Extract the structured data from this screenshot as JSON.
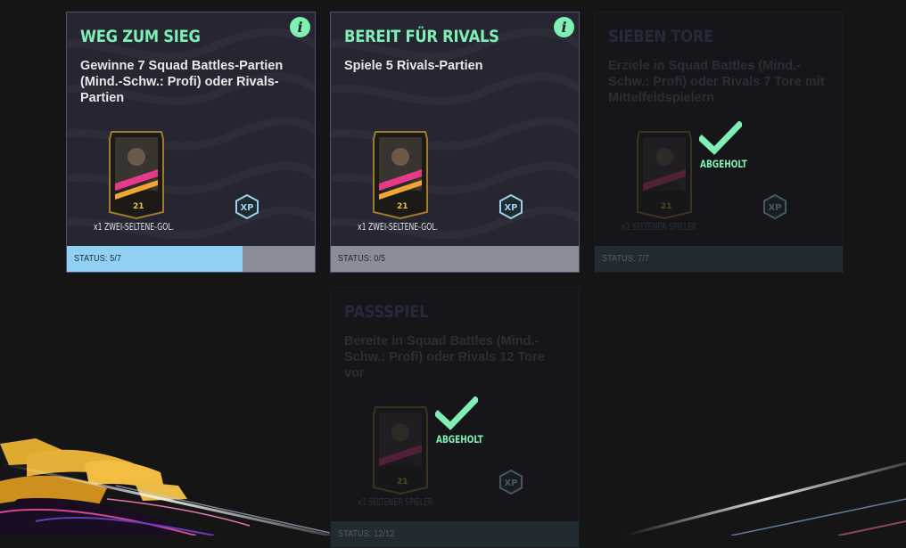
{
  "colors": {
    "accent": "#7ef0b4",
    "progress": "#8fd0f3",
    "card_bg": "#262632"
  },
  "objectives": [
    {
      "title": "WEG ZUM SIEG",
      "description": "Gewinne 7 Squad Battles-Partien (Mind.-Schw.: Profi) oder Rivals-Partien",
      "reward": "x1 ZWEI-SELTENE-GOL...",
      "status": "STATUS: 5/7",
      "progress": 0.71,
      "info_icon": "info-icon",
      "xp_icon": "xp-icon"
    },
    {
      "title": "BEREIT FÜR RIVALS",
      "description": "Spiele 5 Rivals-Partien",
      "reward": "x1 ZWEI-SELTENE-GOL...",
      "status": "STATUS: 0/5",
      "progress": 0.0,
      "info_icon": "info-icon",
      "xp_icon": "xp-icon"
    },
    {
      "title": "SIEBEN TORE",
      "description": "Erziele in Squad Battles (Mind.-Schw.: Profi) oder Rivals 7 Tore mit Mittelfeldspielern",
      "reward": "x1 SELTENER SPIELER ...",
      "status": "STATUS: 7/7",
      "progress": 1.0,
      "claimed_label": "ABGEHOLT",
      "xp_icon": "xp-icon"
    },
    {
      "title": "PASSSPIEL",
      "description": "Bereite in Squad Battles (Mind.-Schw.: Profi) oder Rivals 12 Tore vor",
      "reward": "x1 SELTENER SPIELER ...",
      "status": "STATUS: 12/12",
      "progress": 1.0,
      "claimed_label": "ABGEHOLT",
      "xp_icon": "xp-icon"
    }
  ]
}
